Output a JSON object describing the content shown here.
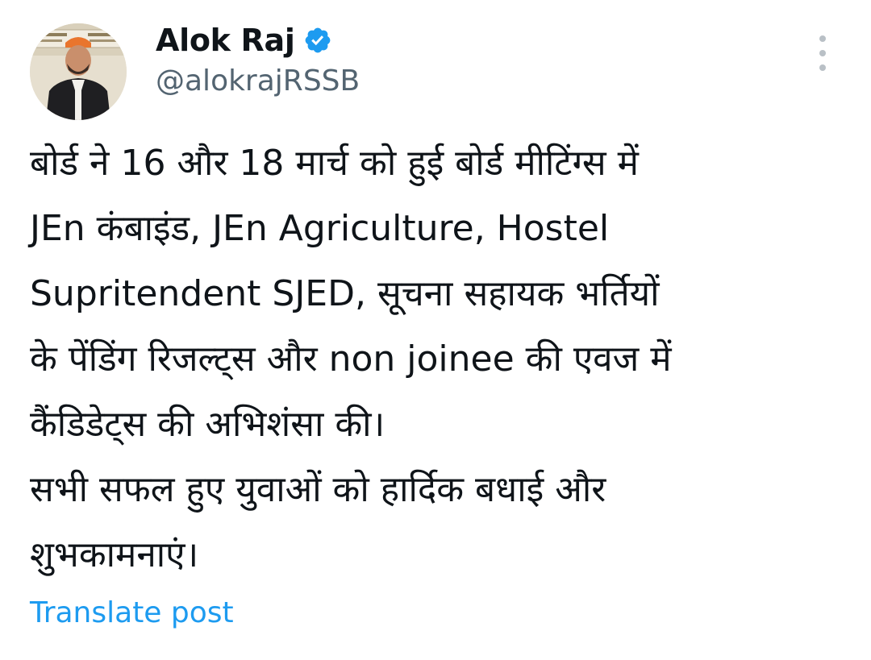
{
  "post": {
    "author": {
      "display_name": "Alok Raj",
      "handle": "@alokrajRSSB",
      "verified": true,
      "avatar_icon": "profile-photo"
    },
    "more_icon": "more-vertical-icon",
    "text_lines": [
      "बोर्ड ने 16 और 18 मार्च को हुई बोर्ड मीटिंग्स में",
      "JEn कंबाइंड, JEn Agriculture, Hostel",
      "Supritendent SJED, सूचना सहायक भर्तियों",
      "के पेंडिंग रिजल्ट्स और non joinee की एवज में",
      "कैंडिडेट्स की अभिशंसा की।",
      "सभी सफल हुए युवाओं को हार्दिक बधाई और",
      "शुभकामनाएं।"
    ],
    "translate_label": "Translate post"
  },
  "colors": {
    "text": "#0f1419",
    "muted": "#536471",
    "link": "#1d9bf0",
    "verified_badge": "#1d9bf0"
  }
}
